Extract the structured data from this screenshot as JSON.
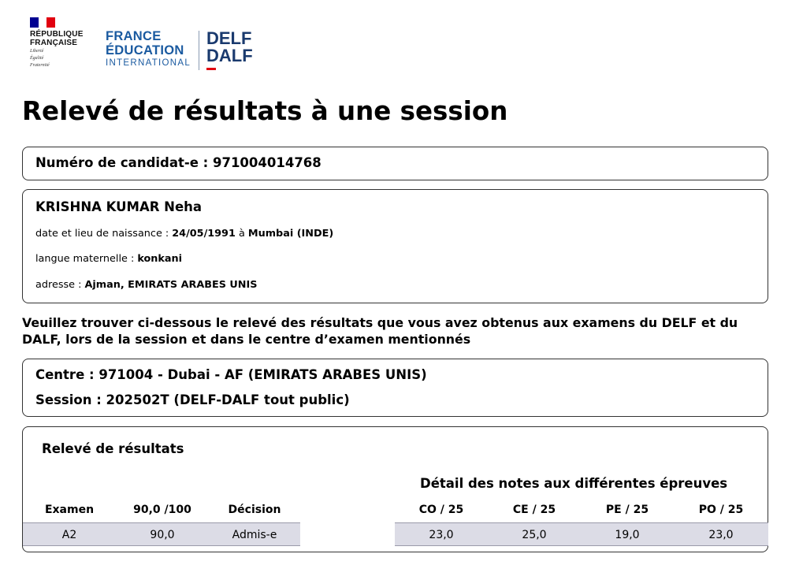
{
  "header": {
    "republique_line1": "RÉPUBLIQUE",
    "republique_line2": "FRANÇAISE",
    "motto1": "Liberté",
    "motto2": "Égalité",
    "motto3": "Fraternité",
    "fei_line1": "FRANCE",
    "fei_line2": "ÉDUCATION",
    "fei_line3": "INTERNATIONAL",
    "delf": "DELF",
    "dalf": "DALF",
    "colors": {
      "blue": "#000091",
      "red": "#e1000f",
      "fei_blue": "#1a5aa0"
    }
  },
  "title": "Relevé de résultats à une session",
  "candidate_number_label": "Numéro de candidat-e : 971004014768",
  "identity": {
    "name": "KRISHNA KUMAR Neha",
    "birth_label": "date et lieu de naissance :",
    "birth_date": "24/05/1991",
    "birth_sep": "à",
    "birth_place": "Mumbai (INDE)",
    "language_label": "langue maternelle :",
    "language": "konkani",
    "address_label": "adresse :",
    "address": "Ajman, EMIRATS ARABES UNIS"
  },
  "intro": "Veuillez trouver ci-dessous le relevé des résultats que vous avez obtenus aux examens du DELF et du DALF, lors de la session et dans le centre d’examen mentionnés",
  "centre": "Centre : 971004 - Dubai - AF (EMIRATS ARABES UNIS)",
  "session": "Session : 202502T (DELF-DALF tout public)",
  "results": {
    "title": "Relevé de résultats",
    "detail_title": "Détail des notes aux différentes épreuves",
    "headers": [
      "Examen",
      "90,0 /100",
      "Décision",
      "CO / 25",
      "CE / 25",
      "PE / 25",
      "PO / 25"
    ],
    "rows": [
      [
        "A2",
        "90,0",
        "Admis-e",
        "23,0",
        "25,0",
        "19,0",
        "23,0"
      ]
    ],
    "row_color": "#dcdce6"
  }
}
